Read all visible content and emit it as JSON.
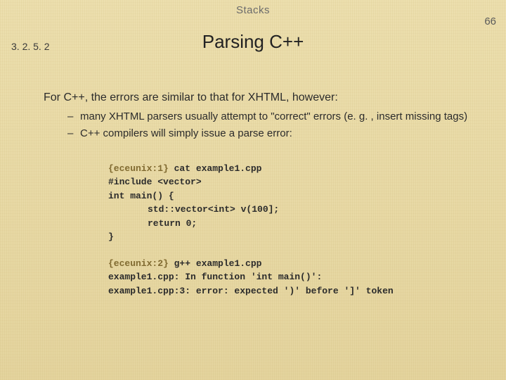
{
  "header": {
    "label": "Stacks",
    "page_number": "66"
  },
  "section": "3. 2. 5. 2",
  "title": "Parsing C++",
  "intro": "For C++, the errors are similar to that for XHTML, however:",
  "bullets": [
    "many XHTML parsers usually attempt to \"correct\" errors (e. g. , insert missing tags)",
    "C++ compilers will simply issue a parse error:"
  ],
  "code": {
    "prompt1": "{eceunix:1}",
    "cmd1": " cat example1.cpp",
    "src": [
      "#include <vector>",
      "int main() {",
      "std::vector<int> v(100];",
      "return 0;",
      "}"
    ],
    "prompt2": "{eceunix:2}",
    "cmd2": " g++ example1.cpp",
    "out": [
      "example1.cpp: In function 'int main()':",
      "example1.cpp:3: error: expected ')' before ']' token"
    ]
  }
}
